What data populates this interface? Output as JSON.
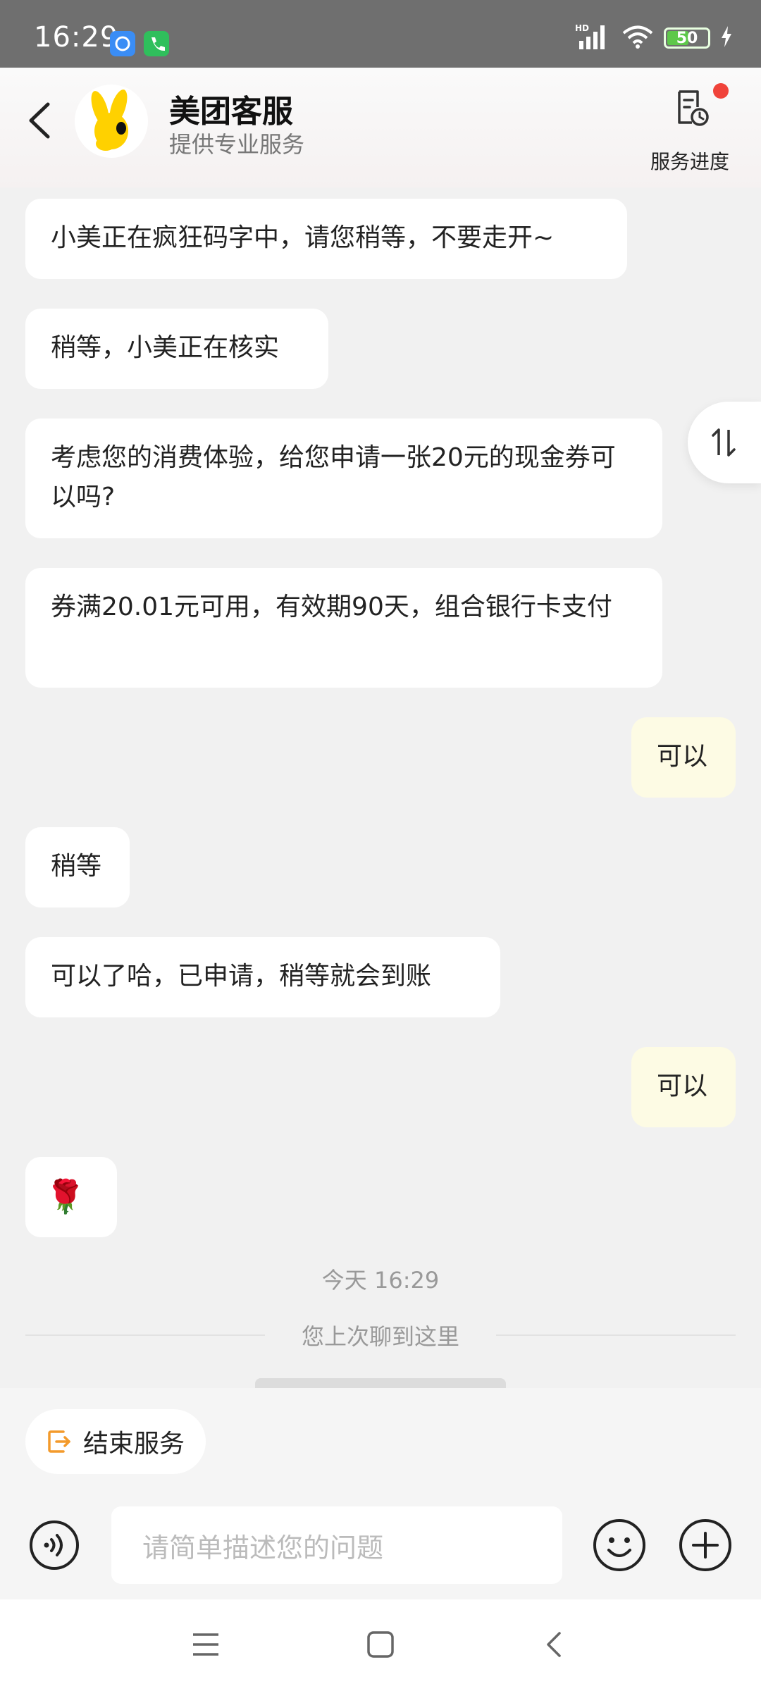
{
  "status_bar": {
    "time": "16:29",
    "network_label": "HD",
    "battery": "50"
  },
  "header": {
    "title": "美团客服",
    "subtitle": "提供专业服务",
    "progress_label": "服务进度"
  },
  "messages": [
    {
      "side": "agent",
      "text": "小美正在疯狂码字中，请您稍等，不要走开~"
    },
    {
      "side": "agent",
      "text": "稍等，小美正在核实"
    },
    {
      "side": "agent",
      "text": "考虑您的消费体验，给您申请一张20元的现金券可以吗?"
    },
    {
      "side": "agent",
      "text": "券满20.01元可用，有效期90天，组合银行卡支付"
    },
    {
      "side": "user",
      "text": "可以"
    },
    {
      "side": "agent",
      "text": "稍等"
    },
    {
      "side": "agent",
      "text": "可以了哈，已申请，稍等就会到账"
    },
    {
      "side": "user",
      "text": "可以"
    },
    {
      "side": "agent",
      "text": "🌹"
    }
  ],
  "timestamp": "今天 16:29",
  "history_divider": "您上次聊到这里",
  "end_service_label": "结束服务",
  "input": {
    "placeholder": "请简单描述您的问题"
  },
  "colors": {
    "user_bubble": "#fdfbe4",
    "agent_bubble": "#ffffff",
    "accent": "#f39a2b",
    "badge": "#f0433a"
  }
}
